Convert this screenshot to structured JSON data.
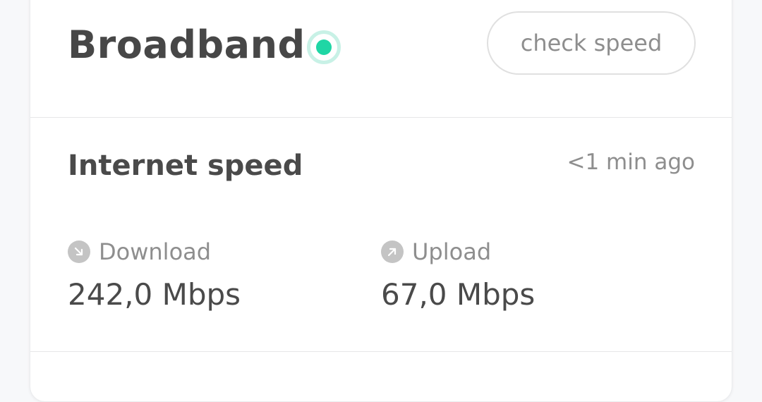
{
  "header": {
    "title": "Broadband",
    "status_color": "#1fd6a5",
    "check_button_label": "check speed"
  },
  "internet_speed": {
    "title": "Internet speed",
    "timestamp": "<1 min ago",
    "download": {
      "label": "Download",
      "value": "242,0 Mbps",
      "icon": "arrow-down-right-icon"
    },
    "upload": {
      "label": "Upload",
      "value": "67,0 Mbps",
      "icon": "arrow-up-right-icon"
    }
  }
}
